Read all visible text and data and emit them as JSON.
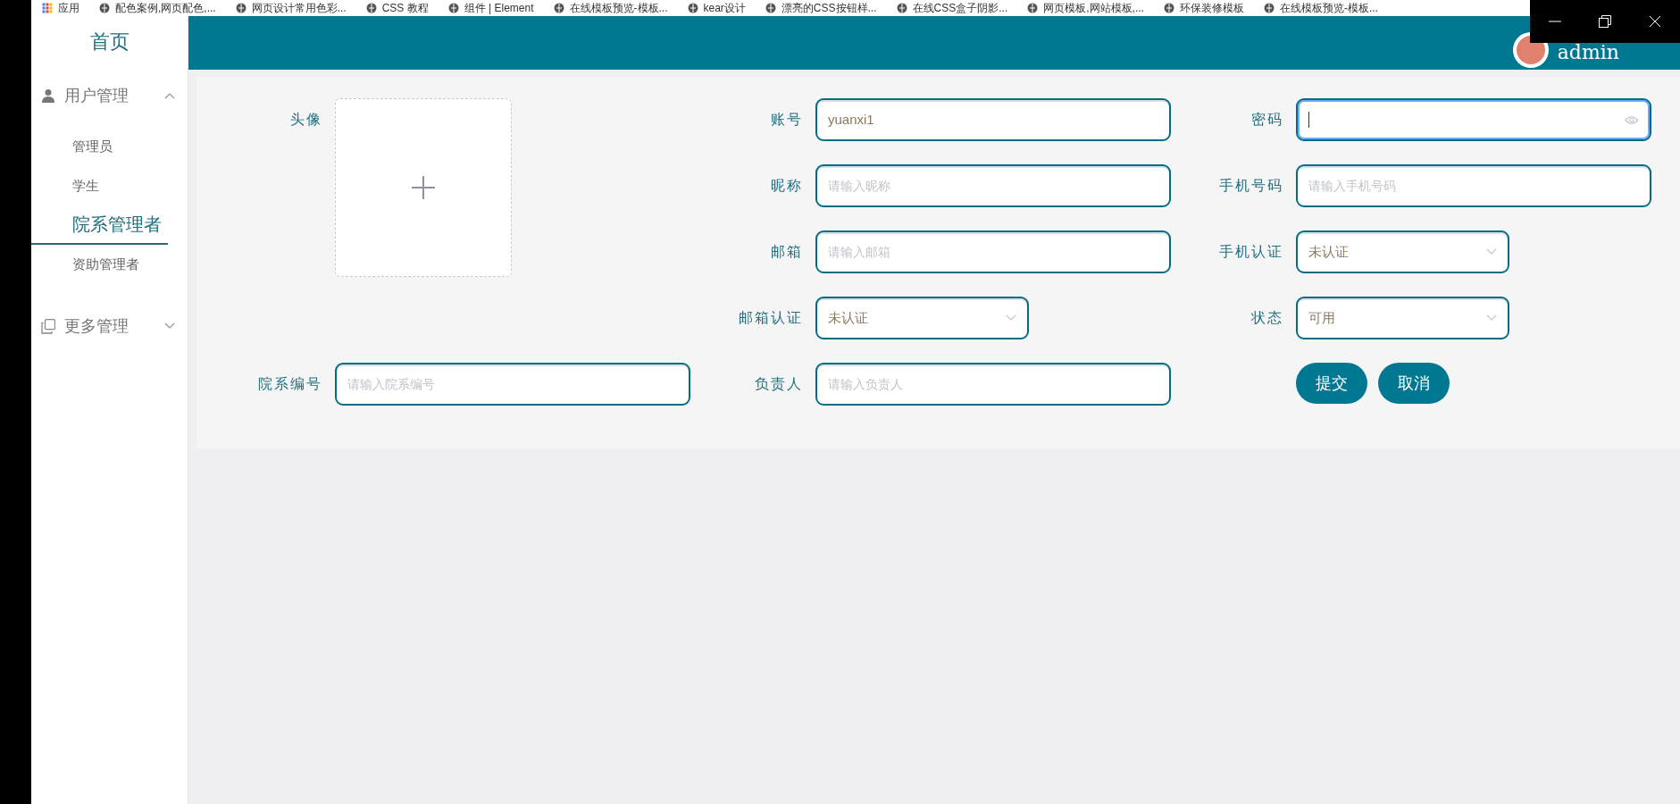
{
  "bookmarks": [
    {
      "label": "应用",
      "kind": "apps"
    },
    {
      "label": "配色案例,网页配色,...",
      "kind": "site"
    },
    {
      "label": "网页设计常用色彩...",
      "kind": "site"
    },
    {
      "label": "CSS 教程",
      "kind": "site"
    },
    {
      "label": "组件 | Element",
      "kind": "site"
    },
    {
      "label": "在线模板预览-模板...",
      "kind": "site"
    },
    {
      "label": "kear设计",
      "kind": "site"
    },
    {
      "label": "漂亮的CSS按钮样...",
      "kind": "site"
    },
    {
      "label": "在线CSS盒子阴影...",
      "kind": "site"
    },
    {
      "label": "网页模板,网站模板,...",
      "kind": "site"
    },
    {
      "label": "环保装修模板",
      "kind": "site"
    },
    {
      "label": "在线模板预览-模板...",
      "kind": "site"
    }
  ],
  "sidebar": {
    "home": "首页",
    "groups": [
      {
        "label": "用户管理",
        "kind": "user",
        "expanded": true,
        "items": [
          {
            "label": "管理员",
            "selected": false
          },
          {
            "label": "学生",
            "selected": false
          },
          {
            "label": "院系管理者",
            "selected": true
          },
          {
            "label": "资助管理者",
            "selected": false
          }
        ]
      },
      {
        "label": "更多管理",
        "kind": "copy",
        "expanded": false
      }
    ]
  },
  "header": {
    "user": "admin"
  },
  "form": {
    "columns": [
      [
        {
          "kind": "upload",
          "label": "头像"
        },
        {
          "kind": "text",
          "label": "院系编号",
          "placeholder": "请输入院系编号"
        }
      ],
      [
        {
          "kind": "text",
          "label": "账号",
          "value": "yuanxi1"
        },
        {
          "kind": "text",
          "label": "昵称",
          "placeholder": "请输入昵称"
        },
        {
          "kind": "text",
          "label": "邮箱",
          "placeholder": "请输入邮箱"
        },
        {
          "kind": "select",
          "label": "邮箱认证",
          "value": "未认证"
        },
        {
          "kind": "text",
          "label": "负责人",
          "placeholder": "请输入负责人"
        }
      ],
      [
        {
          "kind": "password",
          "label": "密码",
          "focused": true
        },
        {
          "kind": "text",
          "label": "手机号码",
          "placeholder": "请输入手机号码"
        },
        {
          "kind": "select",
          "label": "手机认证",
          "value": "未认证"
        },
        {
          "kind": "select",
          "label": "状态",
          "value": "可用"
        }
      ]
    ],
    "buttons": [
      "提交",
      "取消"
    ]
  }
}
